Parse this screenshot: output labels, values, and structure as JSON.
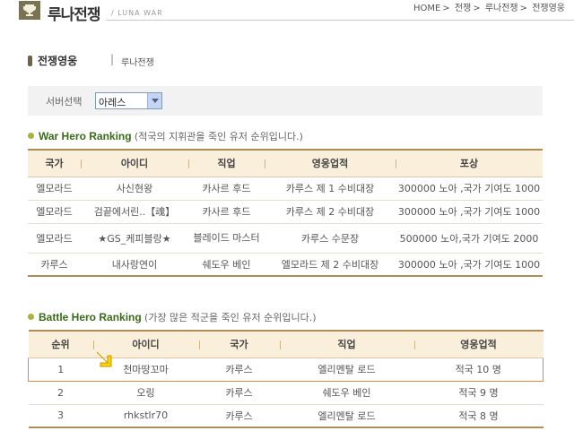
{
  "header": {
    "title": "루나전쟁",
    "subtitle": "/ LUNA WAR",
    "breadcrumb": [
      "HOME",
      "전쟁",
      "루나전쟁",
      "전쟁영웅"
    ]
  },
  "section": {
    "title": "전쟁영웅",
    "separator": "|",
    "sub": "루나전쟁"
  },
  "server": {
    "label": "서버선택",
    "selected": "아레스"
  },
  "war_ranking": {
    "title": "War Hero Ranking",
    "description": "(적국의 지휘관을 죽인 유저 순위입니다.)",
    "columns": [
      "국가",
      "아이디",
      "직업",
      "영웅업적",
      "포상"
    ],
    "rows": [
      [
        "엘모라드",
        "사신현왕",
        "카사르 후드",
        "카루스 제 1 수비대장",
        "300000 노아 ,국가 기여도 1000"
      ],
      [
        "엘모라드",
        "검끝에서린..【魂】",
        "카사르 후드",
        "카루스 제 2 수비대장",
        "300000 노아 ,국가 기여도 1000"
      ],
      [
        "엘모라드",
        "★GS_케피블랑★",
        "블레이드 마스터",
        "카루스 수문장",
        "500000 노아,국가 기여도 2000"
      ],
      [
        "카루스",
        "내사랑연이",
        "쉐도우 베인",
        "엘모라드 제 2 수비대장",
        "300000 노아 ,국가 기여도 1000"
      ]
    ]
  },
  "battle_ranking": {
    "title": "Battle Hero Ranking",
    "description": "(가장 많은 적군을 죽인 유저 순위입니다.)",
    "columns": [
      "순위",
      "아이디",
      "국가",
      "직업",
      "영웅업적"
    ],
    "rows": [
      [
        "1",
        "천마땅꼬마",
        "카루스",
        "엘리멘탈 로드",
        "적국 10 명"
      ],
      [
        "2",
        "오링",
        "카루스",
        "쉐도우 베인",
        "적국 9 명"
      ],
      [
        "3",
        "rhkstlr70",
        "카루스",
        "엘리멘탈 로드",
        "적국 8 명"
      ]
    ]
  },
  "colors": {
    "table_border": "#b08c55",
    "header_bg": "#f9efdb",
    "ranking_title": "#3a6a1a",
    "highlight": "#e8863a"
  }
}
